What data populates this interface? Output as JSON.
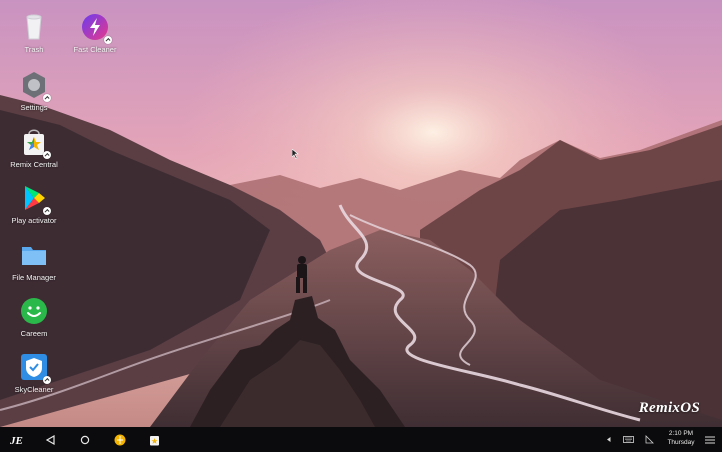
{
  "desktop": {
    "icons": [
      {
        "id": "trash",
        "label": "Trash",
        "icon": "trash-icon"
      },
      {
        "id": "fast-cleaner",
        "label": "Fast Cleaner",
        "icon": "lightning-icon"
      },
      {
        "id": "settings",
        "label": "Settings",
        "icon": "gear-icon"
      },
      {
        "id": "remix-central",
        "label": "Remix Central",
        "icon": "star-bag-icon"
      },
      {
        "id": "play-activator",
        "label": "Play activator",
        "icon": "play-store-icon"
      },
      {
        "id": "file-manager",
        "label": "File Manager",
        "icon": "folder-icon"
      },
      {
        "id": "careem",
        "label": "Careem",
        "icon": "smiley-icon"
      },
      {
        "id": "skycleaner",
        "label": "SkyCleaner",
        "icon": "shield-check-icon"
      }
    ],
    "watermark": "RemixOS"
  },
  "taskbar": {
    "start": "start-menu-icon",
    "nav": [
      "back-icon",
      "home-icon"
    ],
    "pinned": [
      "yellow-app-icon",
      "remix-central-icon"
    ],
    "tray": [
      "caret-left-icon",
      "keyboard-icon",
      "signal-icon"
    ],
    "clock": {
      "time": "2:10 PM",
      "day": "Thursday"
    },
    "menu": "notification-menu-icon"
  },
  "colors": {
    "sky_top": "#d19bc6",
    "sky_mid": "#e7a7b4",
    "horizon": "#f5cdb6",
    "taskbar": "#0b0b0d"
  }
}
